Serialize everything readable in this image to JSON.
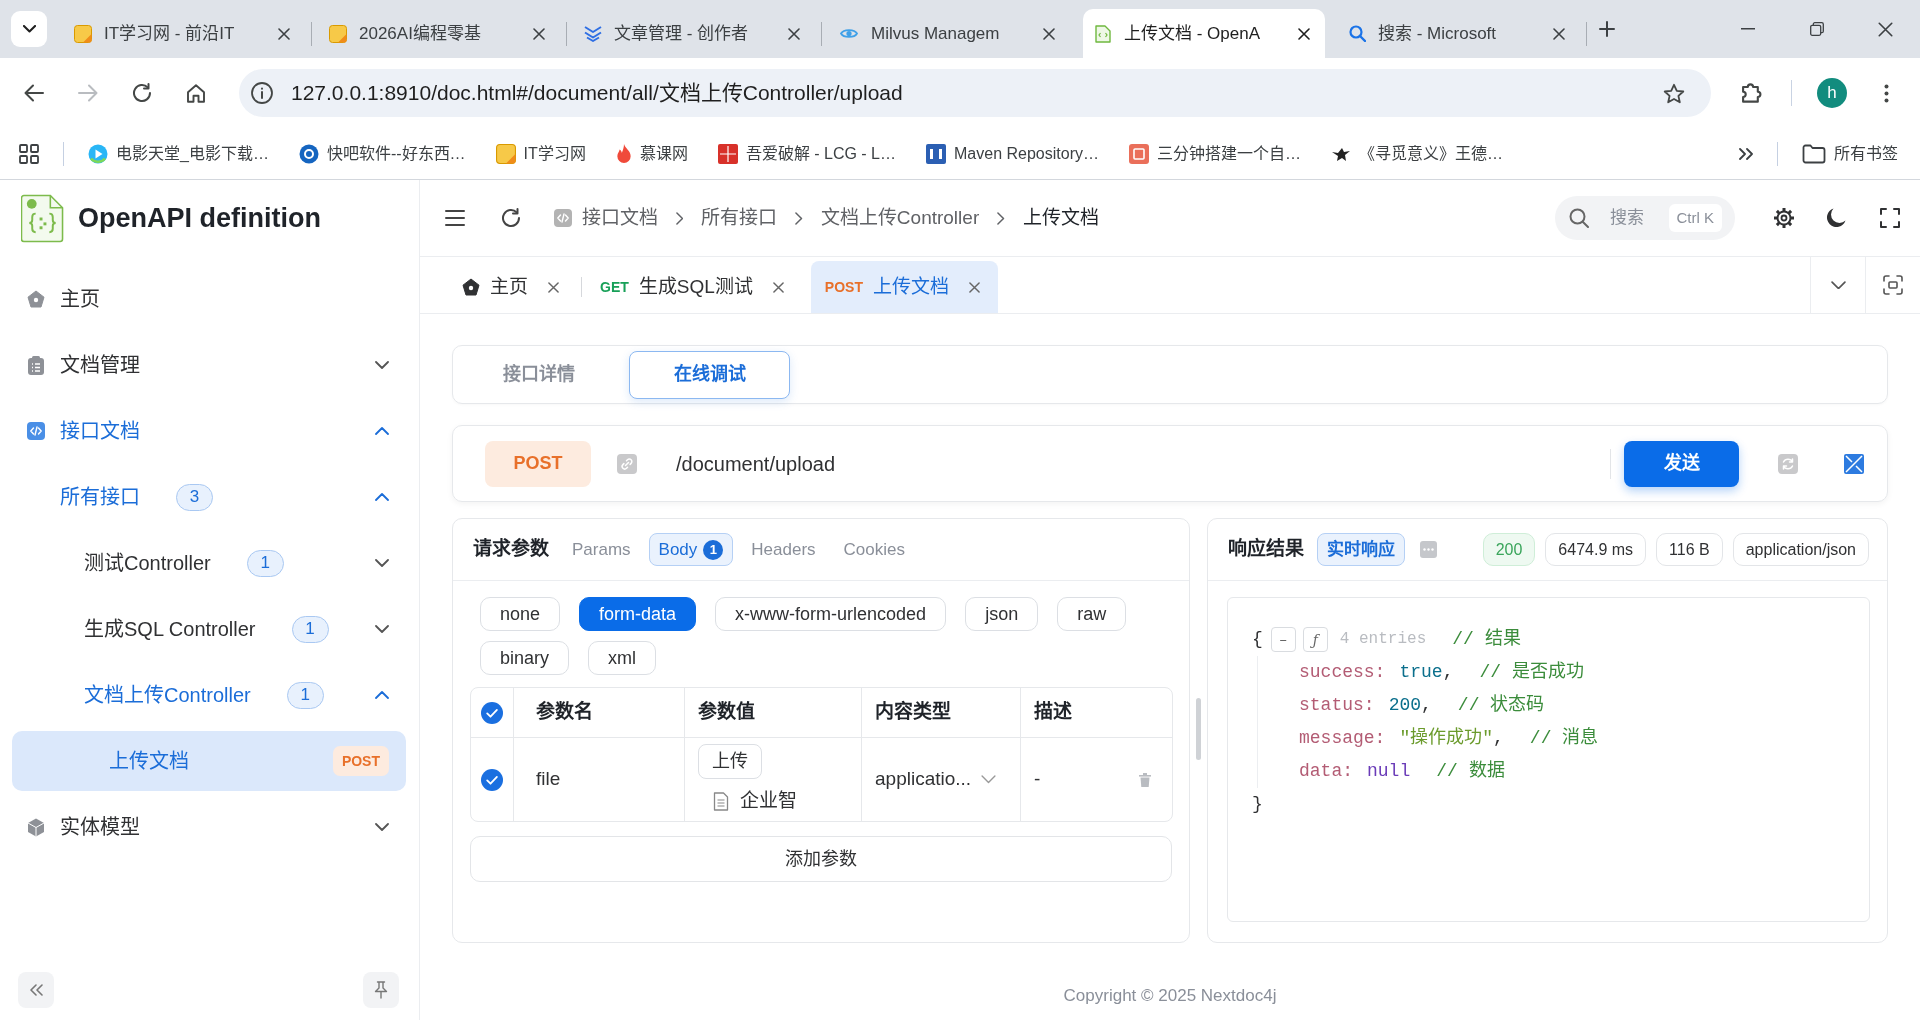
{
  "browser": {
    "tabs": [
      {
        "title": "IT学习网 - 前沿IT",
        "selected": false
      },
      {
        "title": "2026AI编程零基",
        "selected": false
      },
      {
        "title": "文章管理 - 创作者",
        "selected": false
      },
      {
        "title": "Milvus Managem",
        "selected": false
      },
      {
        "title": "上传文档 - OpenA",
        "selected": true
      },
      {
        "title": "搜索 - Microsoft",
        "selected": false
      }
    ],
    "forward_disabled": true,
    "address": "127.0.0.1:8910/doc.html#/document/all/文档上传Controller/upload",
    "profile_initial": "h",
    "bookmarks": [
      "电影天堂_电影下载…",
      "快吧软件--好东西…",
      "IT学习网",
      "慕课网",
      "吾爱破解 - LCG - L…",
      "Maven Repository…",
      "三分钟搭建一个自…",
      "《寻觅意义》王德…"
    ],
    "all_bookmarks": "所有书签"
  },
  "app": {
    "title": "OpenAPI definition",
    "sidebar": {
      "items": [
        {
          "label": "主页",
          "selected": false
        },
        {
          "label": "文档管理",
          "expanded": false,
          "selected": false
        },
        {
          "label": "接口文档",
          "expanded": true,
          "selected": false,
          "children": [
            {
              "label": "所有接口",
              "count": "3",
              "expanded": true,
              "selected": false,
              "children": [
                {
                  "label": "测试Controller",
                  "count": "1",
                  "expanded": false,
                  "selected": false
                },
                {
                  "label": "生成SQL Controller",
                  "count": "1",
                  "expanded": false,
                  "selected": false
                },
                {
                  "label": "文档上传Controller",
                  "count": "1",
                  "expanded": true,
                  "selected": false,
                  "children": [
                    {
                      "label": "上传文档",
                      "method": "POST",
                      "selected": true
                    }
                  ]
                }
              ]
            }
          ]
        },
        {
          "label": "实体模型",
          "expanded": false,
          "selected": false
        }
      ]
    },
    "breadcrumb": [
      "接口文档",
      "所有接口",
      "文档上传Controller",
      "上传文档"
    ],
    "search": {
      "placeholder": "搜索",
      "shortcut": "Ctrl K"
    },
    "tabs": [
      {
        "kind": "home",
        "label": "主页",
        "selected": false
      },
      {
        "kind": "api",
        "method": "GET",
        "label": "生成SQL测试",
        "selected": false
      },
      {
        "kind": "api",
        "method": "POST",
        "label": "上传文档",
        "selected": true
      }
    ],
    "view_tabs": [
      {
        "label": "接口详情",
        "selected": false
      },
      {
        "label": "在线调试",
        "selected": true
      }
    ],
    "request": {
      "method": "POST",
      "path": "/document/upload",
      "send": "发送"
    },
    "params": {
      "title": "请求参数",
      "tabs": [
        {
          "label": "Params",
          "selected": false
        },
        {
          "label": "Body",
          "count": "1",
          "selected": true
        },
        {
          "label": "Headers",
          "selected": false
        },
        {
          "label": "Cookies",
          "selected": false
        }
      ],
      "body_types": [
        {
          "label": "none",
          "selected": false
        },
        {
          "label": "form-data",
          "selected": true
        },
        {
          "label": "x-www-form-urlencoded",
          "selected": false
        },
        {
          "label": "json",
          "selected": false
        },
        {
          "label": "raw",
          "selected": false
        },
        {
          "label": "binary",
          "selected": false
        },
        {
          "label": "xml",
          "selected": false
        }
      ],
      "table": {
        "columns": [
          "参数名",
          "参数值",
          "内容类型",
          "描述"
        ],
        "all_checked": true,
        "rows": [
          {
            "checked": true,
            "name": "file",
            "upload": "上传",
            "file": "企业智",
            "content_type": "applicatio...",
            "description": "-"
          }
        ]
      },
      "add": "添加参数"
    },
    "response": {
      "title": "响应结果",
      "mode": "实时响应",
      "meta": [
        {
          "kind": "status",
          "text": "200"
        },
        {
          "kind": "time",
          "text": "6474.9 ms"
        },
        {
          "kind": "size",
          "text": "116 B"
        },
        {
          "kind": "type",
          "text": "application/json"
        }
      ],
      "body": {
        "open": "{",
        "collapse": "–",
        "format": "ƒ",
        "summary": "4 entries",
        "comment": "// 结果",
        "entries": [
          {
            "key": "success:",
            "value": "true",
            "kind": "boolean",
            "separator": ",",
            "comment": "// 是否成功"
          },
          {
            "key": "status:",
            "value": "200",
            "kind": "number",
            "separator": ",",
            "comment": "// 状态码"
          },
          {
            "key": "message:",
            "value": "\"操作成功\"",
            "kind": "string",
            "separator": ",",
            "comment": "// 消息"
          },
          {
            "key": "data:",
            "value": "null",
            "kind": "null",
            "comment": "// 数据"
          }
        ],
        "close": "}"
      }
    },
    "footer": "Copyright © 2025 Nextdoc4j"
  }
}
